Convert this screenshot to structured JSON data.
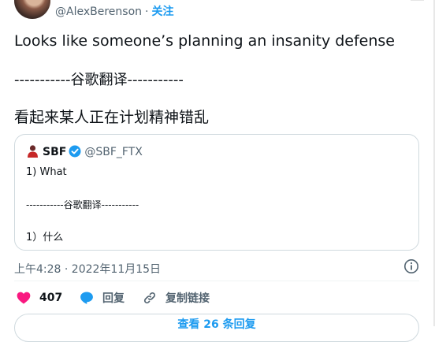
{
  "author": {
    "handle": "@AlexBerenson",
    "follow_label": "关注"
  },
  "tweet": {
    "text": "Looks like someone’s planning an insanity defense",
    "translation_divider": "-----------谷歌翻译-----------",
    "translation": "看起来某人正在计划精神错乱"
  },
  "quoted": {
    "name": "SBF",
    "handle": "@SBF_FTX",
    "text": "1) What",
    "translation_divider": "-----------谷歌翻译-----------",
    "translation": "1）什么"
  },
  "timestamp": "上午4:28 · 2022年11月15日",
  "actions": {
    "like_count": "407",
    "reply_label": "回复",
    "share_label": "复制链接"
  },
  "read_replies_label": "查看 26 条回复",
  "colors": {
    "accent": "#1d9bf0",
    "like": "#f91880",
    "muted": "#536471",
    "border": "#cfd9de"
  },
  "icons": [
    "heart-icon",
    "reply-icon",
    "link-icon",
    "info-icon",
    "verified-badge-icon"
  ]
}
